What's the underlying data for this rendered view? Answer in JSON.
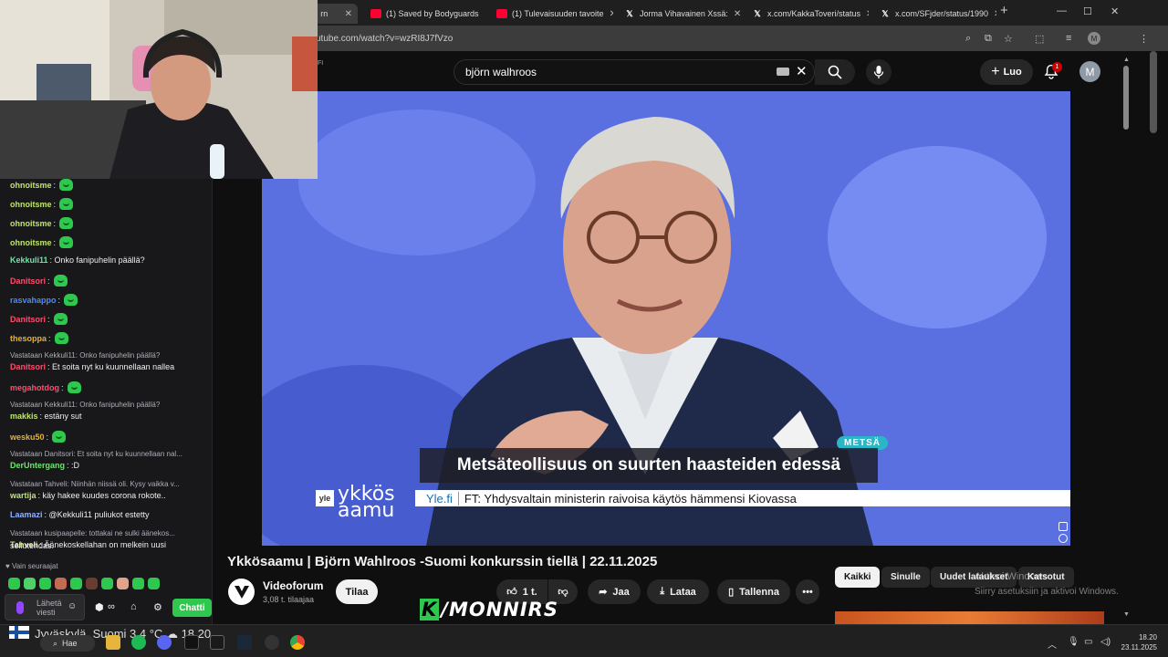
{
  "browser": {
    "tabs": [
      {
        "title": "rn",
        "type": "yt"
      },
      {
        "title": "(1) Saved by Bodyguards",
        "type": "yt"
      },
      {
        "title": "(1) Tulevaisuuden tavoite",
        "type": "yt"
      },
      {
        "title": "Jorma Vihavainen Xssä: ",
        "type": "x"
      },
      {
        "title": "x.com/KakkaToveri/status",
        "type": "x"
      },
      {
        "title": "x.com/SFjder/status/1990",
        "type": "x"
      }
    ],
    "url": "utube.com/watch?v=wzRI8J7fVzo",
    "profile_initial": "M"
  },
  "youtube": {
    "logo_suffix": "FI",
    "search_value": "björn walhroos",
    "create_label": "Luo",
    "notifications_count": "1",
    "avatar_initial": "M"
  },
  "video": {
    "tag": "METSÄ",
    "headline": "Metsäteollisuus on suurten haasteiden edessä",
    "ticker_source": "Yle.fi",
    "ticker_text": "FT: Yhdysvaltain ministerin raivoisa käytös hämmensi Kiovassa",
    "show_logo_1": "ykkös",
    "show_logo_2": "aamu",
    "yle_mark": "yle"
  },
  "meta": {
    "title": "Ykkösaamu | Björn Wahlroos -Suomi konkurssin tiellä | 22.11.2025",
    "channel": "Videoforum",
    "subscribers": "3,08 t. tilaajaa",
    "subscribe_label": "Tilaa",
    "likes": "1 t.",
    "share_label": "Jaa",
    "download_label": "Lataa",
    "save_label": "Tallenna"
  },
  "chips": [
    "Kaikki",
    "Sinulle",
    "Uudet lataukset",
    "Katsotut"
  ],
  "windows_notice": {
    "line1": "Aktivoi Windows",
    "line2": "Siirry asetuksiin ja aktivoi Windows."
  },
  "chat": {
    "messages": [
      {
        "user": "ohnoitsme",
        "color": "#bfe46e",
        "text": ":",
        "emote": true,
        "reply": ""
      },
      {
        "user": "ohnoitsme",
        "color": "#bfe46e",
        "text": ":",
        "emote": true,
        "reply": ""
      },
      {
        "user": "ohnoitsme",
        "color": "#bfe46e",
        "text": ":",
        "emote": true,
        "reply": ""
      },
      {
        "user": "ohnoitsme",
        "color": "#bfe46e",
        "text": ":",
        "emote": true,
        "reply": ""
      },
      {
        "user": "Kekkuli11",
        "color": "#6fe4a5",
        "text": ": Onko fanipuhelin päällä?",
        "emote": false,
        "reply": ""
      },
      {
        "user": "Danitsori",
        "color": "#ff4d6d",
        "text": ":",
        "emote": true,
        "reply": ""
      },
      {
        "user": "rasvahappo",
        "color": "#4b8bff",
        "text": ":",
        "emote": true,
        "reply": ""
      },
      {
        "user": "Danitsori",
        "color": "#ff4d6d",
        "text": ":",
        "emote": true,
        "reply": ""
      },
      {
        "user": "thesoppa",
        "color": "#e5b130",
        "text": ":",
        "emote": true,
        "reply": ""
      },
      {
        "user": "Danitsori",
        "color": "#ff4d6d",
        "text": ": Et soita nyt ku kuunnellaan nallea",
        "emote": false,
        "reply": "Vastataan Kekkuli11: Onko fanipuhelin päällä?"
      },
      {
        "user": "megahotdog",
        "color": "#ff4d6d",
        "text": ":",
        "emote": true,
        "reply": ""
      },
      {
        "user": "makkis",
        "color": "#bfe46e",
        "text": ": estäny sut",
        "emote": false,
        "reply": "Vastataan Kekkuli11: Onko fanipuhelin päällä?"
      },
      {
        "user": "wesku50",
        "color": "#e5b130",
        "text": ":",
        "emote": true,
        "reply": ""
      },
      {
        "user": "DerUntergang",
        "color": "#6fe46e",
        "text": ": :D",
        "emote": false,
        "reply": "Vastataan Danitsori: Et soita nyt ku kuunnellaan nal..."
      },
      {
        "user": "wartija",
        "color": "#bfe46e",
        "text": ": käy hakee kuudes corona rokote..",
        "emote": false,
        "reply": "Vastataan Tahveli: Niinhän niissä oli. Kysy vaikka v..."
      },
      {
        "user": "Laamazi",
        "color": "#8fb0ff",
        "text": ": @Kekkuli11 puliukot estetty",
        "emote": false,
        "reply": ""
      },
      {
        "user": "Tahveli",
        "color": "#bfe46e",
        "text": ": Äänekoskellahan on melkein uusi",
        "emote": false,
        "reply": "Vastataan kusipaapelle: tottakai ne sulki äänekos..."
      }
    ],
    "last_line_2": "sellutehdas.",
    "follow_only": "Vain seuraajat",
    "input_placeholder_1": "Lähetä",
    "input_placeholder_2": "viesti",
    "send_label": "Chatti",
    "accent": "#2fc84f"
  },
  "overlay_brand": "/MONNIRS",
  "overlay_brand_k": "K",
  "taskbar": {
    "weather": "Jyväskylä, Suomi   3,4 °C",
    "weather_time": "18.20",
    "search_label": "Hae",
    "clock_time": "18.20",
    "clock_date": "23.11.2025"
  }
}
